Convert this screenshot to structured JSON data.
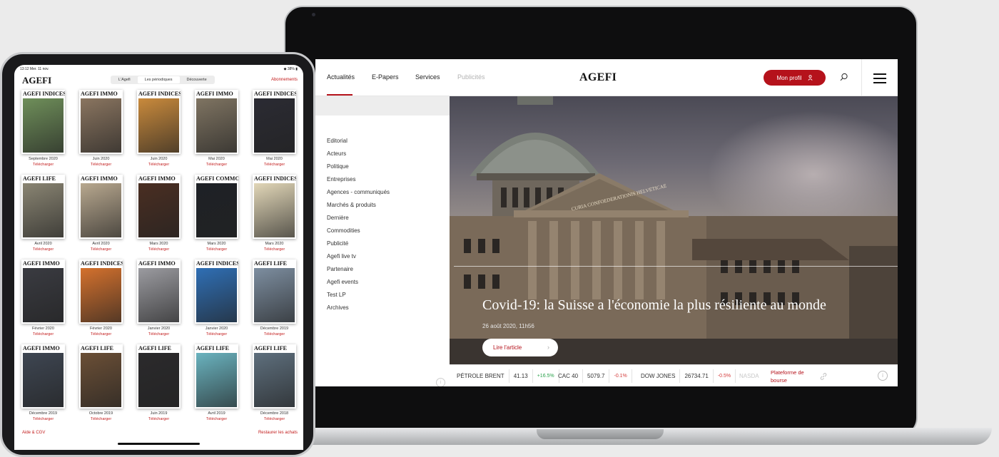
{
  "website": {
    "nav": [
      {
        "label": "Actualités",
        "dim": false
      },
      {
        "label": "E-Papers",
        "dim": false
      },
      {
        "label": "Services",
        "dim": false
      },
      {
        "label": "Publicités",
        "dim": true
      }
    ],
    "logo": "AGEFI",
    "profile_button": "Mon profil",
    "sidebar_items": [
      "Editorial",
      "Acteurs",
      "Politique",
      "Entreprises",
      "Agences - communiqués",
      "Marchés & produits",
      "Dernière",
      "Commodities",
      "Publicité",
      "Agefi live tv",
      "Partenaire",
      "Agefi events",
      "Test LP",
      "Archives"
    ],
    "hero": {
      "headline": "Covid-19: la Suisse a l'économie la plus résiliente au monde",
      "date": "26 août 2020, 11h56",
      "read_button": "Lire l'article",
      "read_arrow": "›",
      "inscription": "CURIA CONFOEDERATIONIS HELVETICAE"
    },
    "ticker": [
      {
        "name": "PÉTROLE BRENT",
        "value": "41.13",
        "change": "+16.5%",
        "dir": "pos"
      },
      {
        "name": "CAC 40",
        "value": "5079.7",
        "change": "-0.1%",
        "dir": "neg"
      },
      {
        "name": "DOW JONES",
        "value": "26734.71",
        "change": "-0.5%",
        "dir": "neg"
      },
      {
        "name": "NASDA",
        "value": "",
        "change": "",
        "dir": ""
      }
    ],
    "bourse_link": "Plateforme de bourse",
    "info_glyph": "i"
  },
  "tablet": {
    "status_time": "13:12  Mer. 11 nov.",
    "status_battery": "38%",
    "logo": "AGEFI",
    "segments": [
      {
        "label": "L'Agefi",
        "active": false
      },
      {
        "label": "Les périodiques",
        "active": true
      },
      {
        "label": "Découverte",
        "active": false
      }
    ],
    "subscriptions": "Abonnements",
    "download_label": "Télécharger",
    "covers": [
      {
        "title": "AGEFI INDICES",
        "date": "Septembre 2020",
        "color": "#6f8f5a"
      },
      {
        "title": "AGEFI IMMO",
        "date": "Juin 2020",
        "color": "#8a7560"
      },
      {
        "title": "AGEFI INDICES",
        "date": "Juin 2020",
        "color": "#c98a3c"
      },
      {
        "title": "AGEFI IMMO",
        "date": "Mai 2020",
        "color": "#7f7462"
      },
      {
        "title": "AGEFI INDICES",
        "date": "Mai 2020",
        "color": "#2b2b33"
      },
      {
        "title": "AGEFI LIFE",
        "date": "Avril 2020",
        "color": "#8a8573"
      },
      {
        "title": "AGEFI IMMO",
        "date": "Avril 2020",
        "color": "#b8a88f"
      },
      {
        "title": "AGEFI IMMO",
        "date": "Mars 2020",
        "color": "#4a2e22"
      },
      {
        "title": "AGEFI COMMODITIES",
        "date": "Mars 2020",
        "color": "#1e2126"
      },
      {
        "title": "AGEFI INDICES",
        "date": "Mars 2020",
        "color": "#e2d7b8"
      },
      {
        "title": "AGEFI IMMO",
        "date": "Février 2020",
        "color": "#3a3b41"
      },
      {
        "title": "AGEFI INDICES",
        "date": "Février 2020",
        "color": "#d4712d"
      },
      {
        "title": "AGEFI IMMO",
        "date": "Janvier 2020",
        "color": "#9b9ba0"
      },
      {
        "title": "AGEFI INDICES",
        "date": "Janvier 2020",
        "color": "#2f6fb5"
      },
      {
        "title": "AGEFI LIFE",
        "date": "Décembre 2019",
        "color": "#7d8ea0"
      },
      {
        "title": "AGEFI IMMO",
        "date": "Décembre 2019",
        "color": "#3e4652"
      },
      {
        "title": "AGEFI LIFE",
        "date": "Octobre 2019",
        "color": "#6b4f36"
      },
      {
        "title": "AGEFI LIFE",
        "date": "Juin 2019",
        "color": "#2b2a2c"
      },
      {
        "title": "AGEFI LIFE",
        "date": "Avril 2019",
        "color": "#6ab3bf"
      },
      {
        "title": "AGEFI LIFE",
        "date": "Décembre 2018",
        "color": "#5e6f7d"
      }
    ],
    "footer_left": "Aide & CGV",
    "footer_right": "Restaurer les achats"
  },
  "colors": {
    "brand_red": "#b5121b",
    "positive": "#2ba24c",
    "negative": "#d43a3a"
  }
}
